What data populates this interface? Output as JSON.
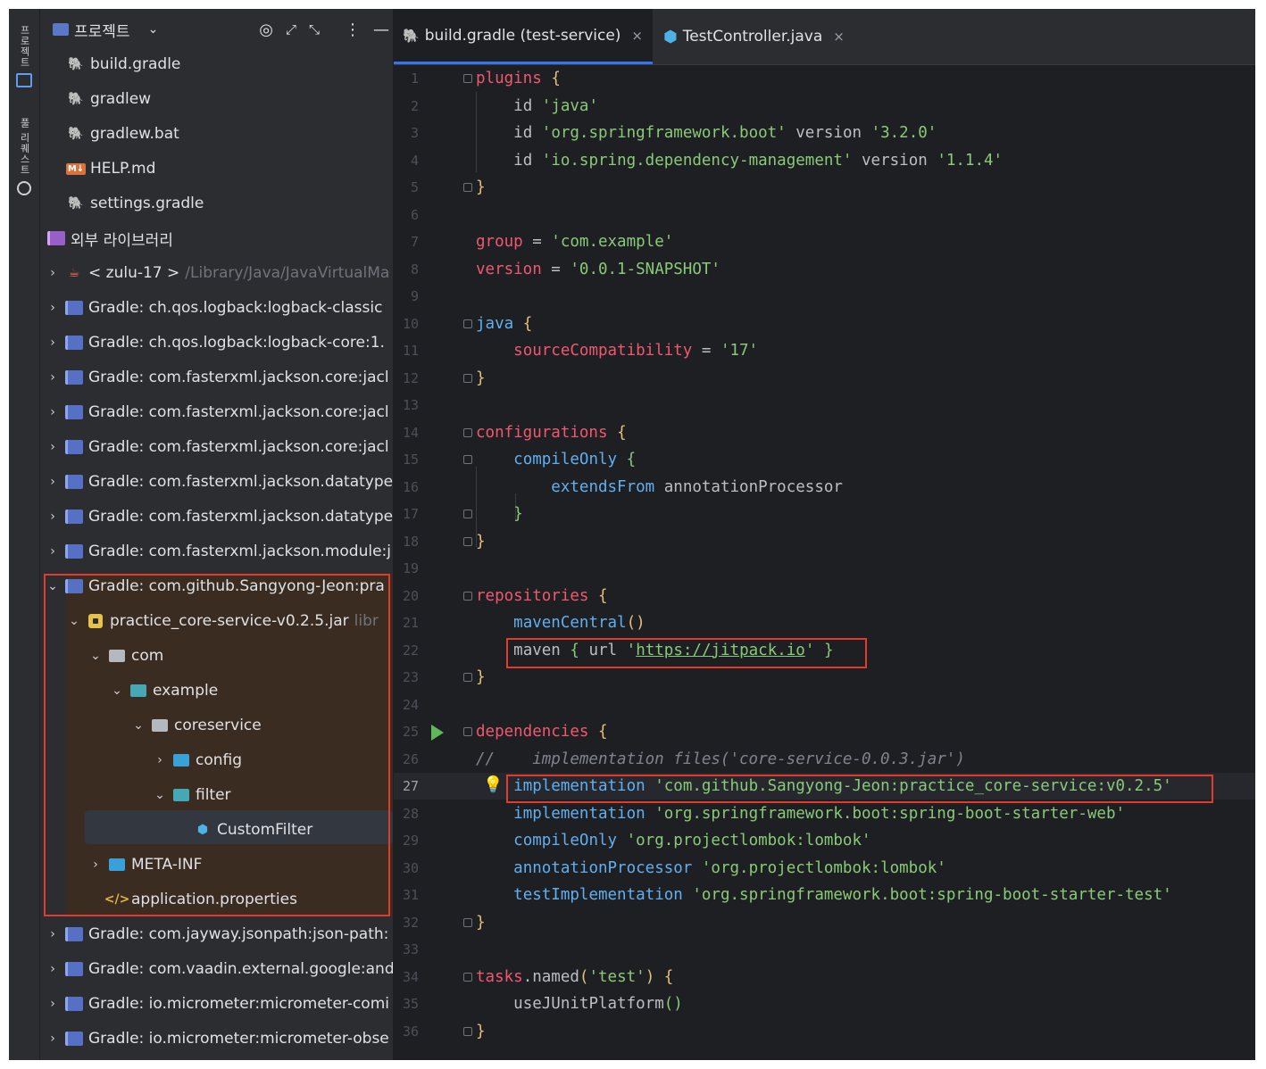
{
  "stripe": {
    "project_label": "프로젝트",
    "pr_label": "풀 리퀘스트"
  },
  "project_panel": {
    "title": "프로젝트"
  },
  "tree": [
    {
      "label": "build.gradle",
      "icon": "gradle-icon"
    },
    {
      "label": "gradlew",
      "icon": "gradle-purple-icon"
    },
    {
      "label": "gradlew.bat",
      "icon": "gradle-purple-icon"
    },
    {
      "label": "HELP.md",
      "icon": "markdown-icon"
    },
    {
      "label": "settings.gradle",
      "icon": "gradle-icon"
    },
    {
      "label": "외부 라이브러리",
      "icon": "library-icon"
    },
    {
      "label": "< zulu-17 >",
      "extra": "/Library/Java/JavaVirtualMa",
      "icon": "java-icon"
    },
    {
      "label": "Gradle: ch.qos.logback:logback-classic",
      "icon": "library-icon"
    },
    {
      "label": "Gradle: ch.qos.logback:logback-core:1.",
      "icon": "library-icon"
    },
    {
      "label": "Gradle: com.fasterxml.jackson.core:jacl",
      "icon": "library-icon"
    },
    {
      "label": "Gradle: com.fasterxml.jackson.core:jacl",
      "icon": "library-icon"
    },
    {
      "label": "Gradle: com.fasterxml.jackson.core:jacl",
      "icon": "library-icon"
    },
    {
      "label": "Gradle: com.fasterxml.jackson.datatype",
      "icon": "library-icon"
    },
    {
      "label": "Gradle: com.fasterxml.jackson.datatype",
      "icon": "library-icon"
    },
    {
      "label": "Gradle: com.fasterxml.jackson.module:j",
      "icon": "library-icon"
    },
    {
      "label": "Gradle: com.github.Sangyong-Jeon:pra",
      "icon": "library-icon"
    },
    {
      "label": "practice_core-service-v0.2.5.jar",
      "extra": "libr",
      "icon": "jar-icon"
    },
    {
      "label": "com",
      "icon": "folder-icon"
    },
    {
      "label": "example",
      "icon": "package-icon"
    },
    {
      "label": "coreservice",
      "icon": "folder-icon"
    },
    {
      "label": "config",
      "icon": "config-folder-icon"
    },
    {
      "label": "filter",
      "icon": "package-icon"
    },
    {
      "label": "CustomFilter",
      "icon": "class-icon"
    },
    {
      "label": "META-INF",
      "icon": "folder-icon"
    },
    {
      "label": "application.properties",
      "icon": "properties-icon"
    },
    {
      "label": "Gradle: com.jayway.jsonpath:json-path:",
      "icon": "library-icon"
    },
    {
      "label": "Gradle: com.vaadin.external.google:and",
      "icon": "library-icon"
    },
    {
      "label": "Gradle: io.micrometer:micrometer-comi",
      "icon": "library-icon"
    },
    {
      "label": "Gradle: io.micrometer:micrometer-obse",
      "icon": "library-icon"
    }
  ],
  "tabs": [
    {
      "label": "build.gradle (test-service)",
      "active": true
    },
    {
      "label": "TestController.java",
      "active": false
    }
  ],
  "code": {
    "l1": "plugins",
    "l2a": "id",
    "l2b": "'java'",
    "l3a": "id",
    "l3b": "'org.springframework.boot'",
    "l3c": "version",
    "l3d": "'3.2.0'",
    "l4a": "id",
    "l4b": "'io.spring.dependency-management'",
    "l4c": "version",
    "l4d": "'1.1.4'",
    "l7a": "group",
    "l7b": "'com.example'",
    "l8a": "version",
    "l8b": "'0.0.1-SNAPSHOT'",
    "l10": "java",
    "l11a": "sourceCompatibility",
    "l11b": "'17'",
    "l14": "configurations",
    "l15": "compileOnly",
    "l16a": "extendsFrom",
    "l16b": "annotationProcessor",
    "l20": "repositories",
    "l21": "mavenCentral",
    "l22a": "maven",
    "l22b": "url",
    "l22c": "https://jitpack.io",
    "l25": "dependencies",
    "l26": "//    implementation files('core-service-0.0.3.jar')",
    "l27a": "implementation",
    "l27b": "'com.github.Sangyong-Jeon:practice_core-service:v0.2.5'",
    "l28a": "implementation",
    "l28b": "'org.springframework.boot:spring-boot-starter-web'",
    "l29a": "compileOnly",
    "l29b": "'org.projectlombok:lombok'",
    "l30a": "annotationProcessor",
    "l30b": "'org.projectlombok:lombok'",
    "l31a": "testImplementation",
    "l31b": "'org.springframework.boot:spring-boot-starter-test'",
    "l34a": "tasks",
    "l34b": "named",
    "l34c": "'test'",
    "l35": "useJUnitPlatform"
  },
  "line_numbers": [
    "1",
    "2",
    "3",
    "4",
    "5",
    "6",
    "7",
    "8",
    "9",
    "10",
    "11",
    "12",
    "13",
    "14",
    "15",
    "16",
    "17",
    "18",
    "19",
    "20",
    "21",
    "22",
    "23",
    "24",
    "25",
    "26",
    "27",
    "28",
    "29",
    "30",
    "31",
    "32",
    "33",
    "34",
    "35",
    "36"
  ],
  "colors": {
    "accent": "#3574f0",
    "highlight": "#e23a2b",
    "keyword": "#ef596f",
    "string": "#89ca78",
    "method": "#61afef"
  }
}
